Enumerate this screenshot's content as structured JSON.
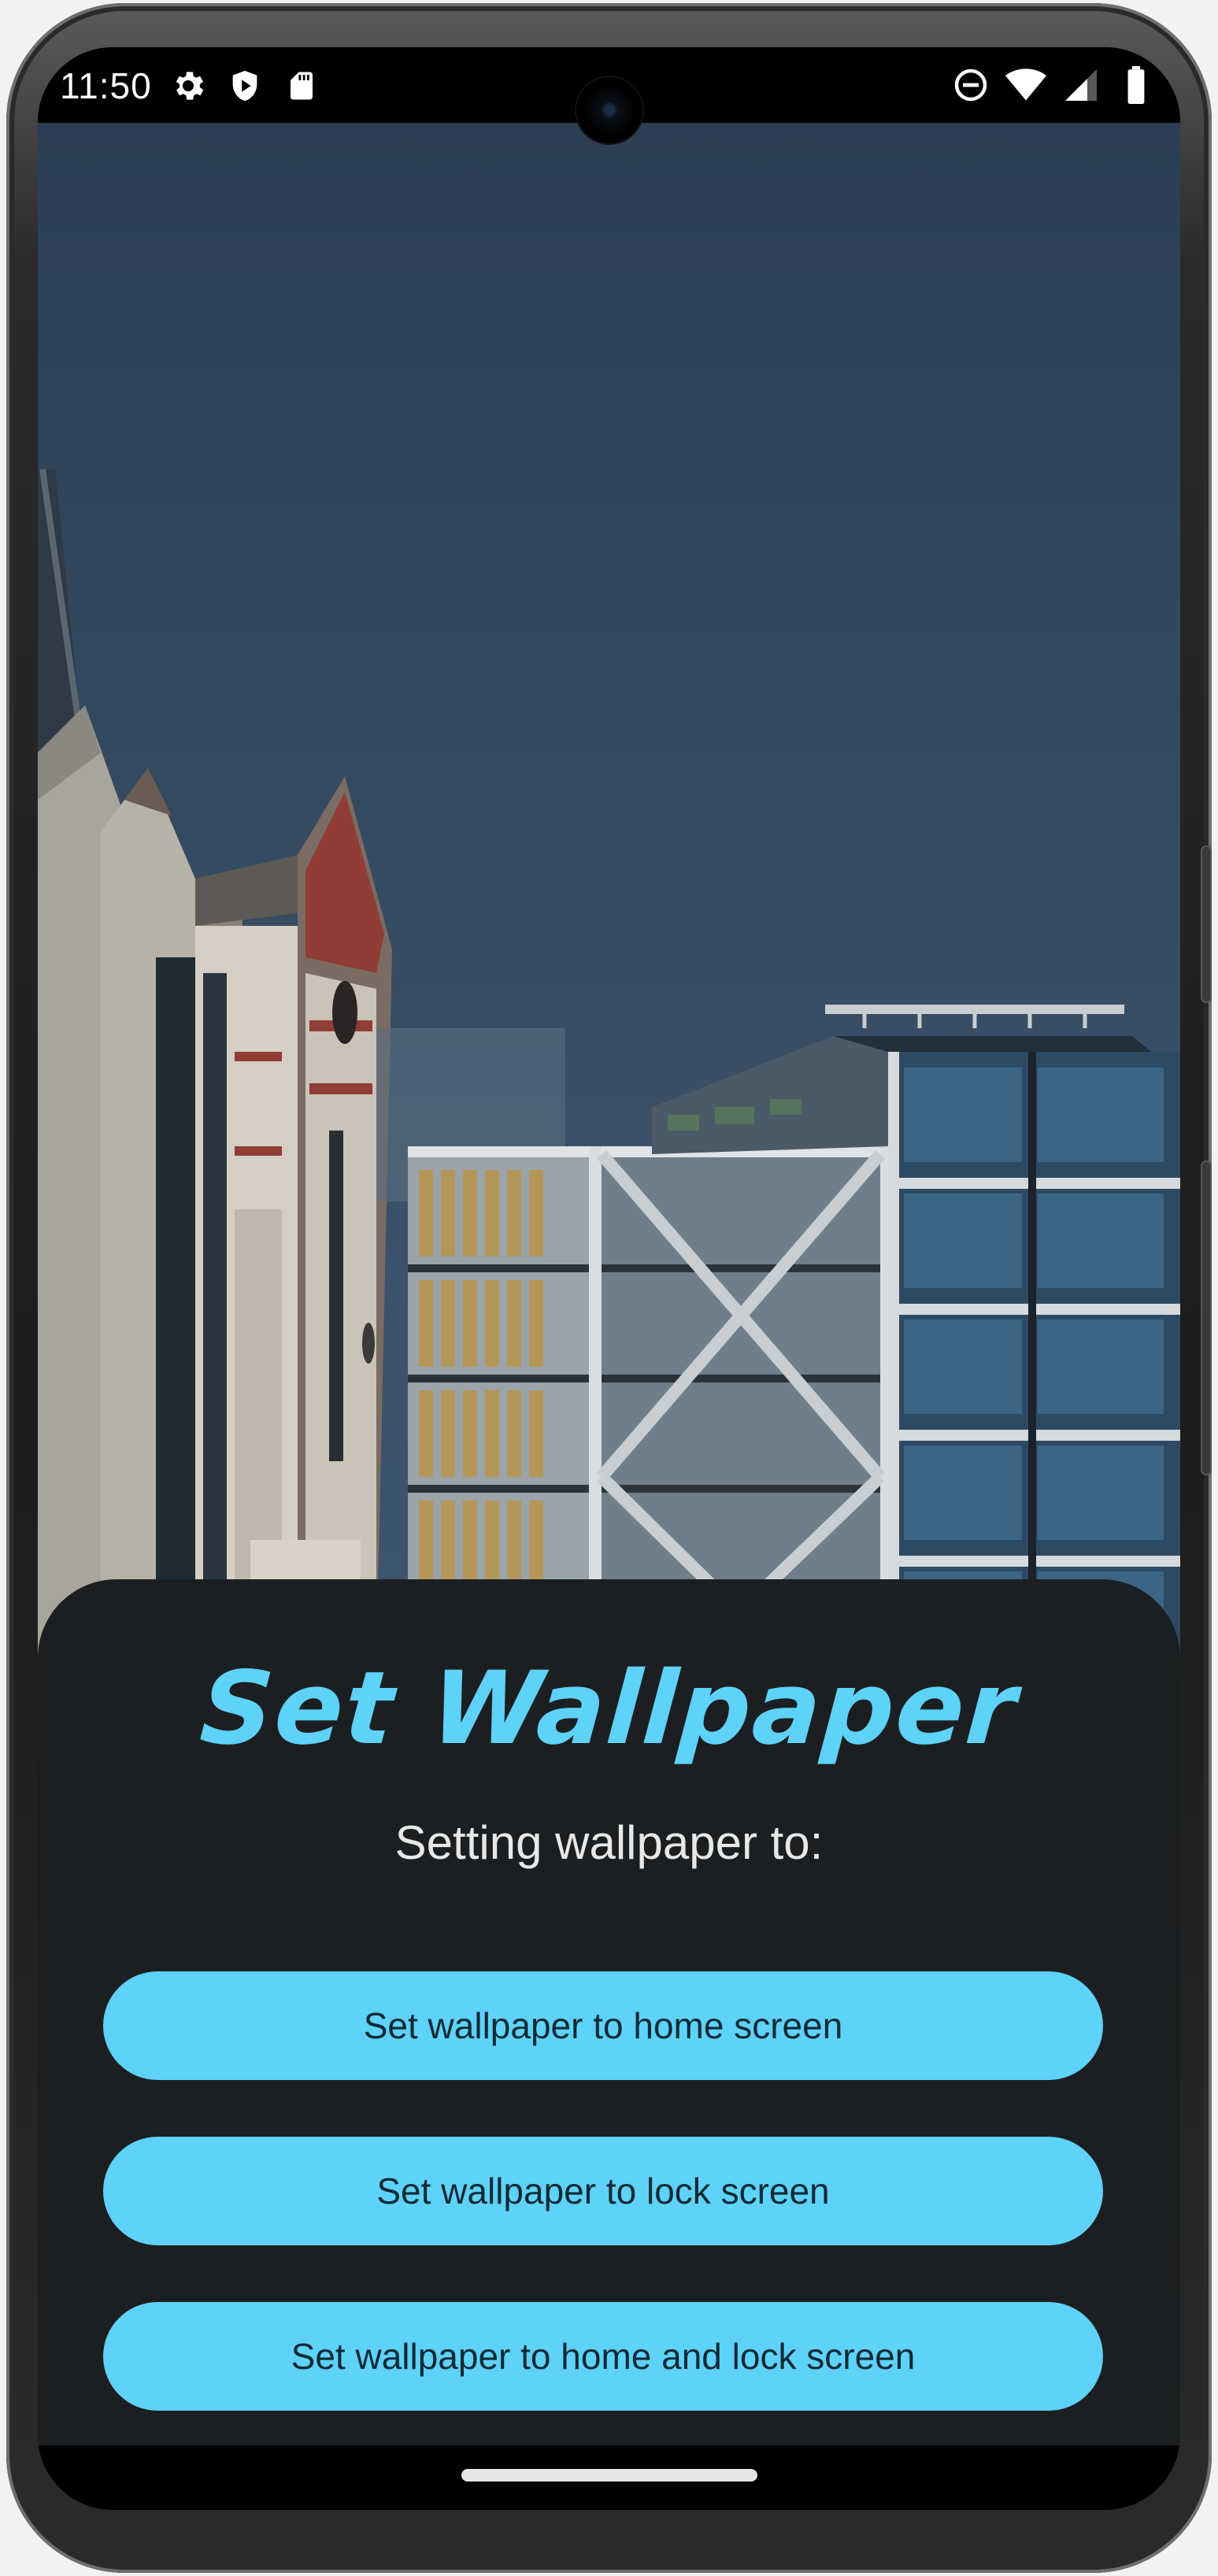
{
  "status_bar": {
    "time": "11:50",
    "left_icons": [
      "gear-icon",
      "shield-play-icon",
      "sd-card-icon"
    ],
    "right_icons": [
      "do-not-disturb-icon",
      "wifi-icon",
      "cellular-signal-icon",
      "battery-icon"
    ]
  },
  "sheet": {
    "title": "Set Wallpaper",
    "subtitle": "Setting wallpaper to:",
    "buttons": [
      {
        "label": "Set wallpaper to home screen"
      },
      {
        "label": "Set wallpaper to lock screen"
      },
      {
        "label": "Set wallpaper to home and lock screen"
      }
    ]
  },
  "colors": {
    "accent": "#5ed2f8",
    "sheet_background": "#1b1f21",
    "button_text": "#0f2a35"
  }
}
